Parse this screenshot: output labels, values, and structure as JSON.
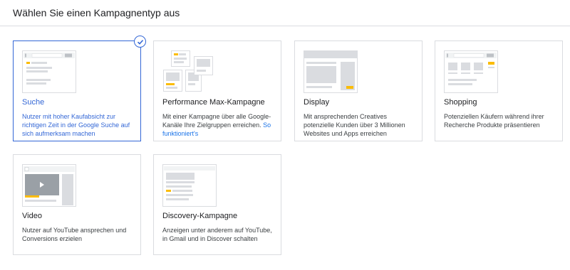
{
  "header": {
    "title": "Wählen Sie einen Kampagnentyp aus"
  },
  "cards": [
    {
      "key": "search",
      "title": "Suche",
      "desc": "Nutzer mit hoher Kaufabsicht zur richtigen Zeit in der Google Suche auf sich aufmerksam machen",
      "selected": true,
      "icon": "search-thumbnail"
    },
    {
      "key": "pmax",
      "title": "Performance Max-Kampagne",
      "desc": "Mit einer Kampagne über alle Google-Kanäle Ihre Zielgruppen erreichen.",
      "link": "So funktioniert's",
      "icon": "pmax-thumbnail"
    },
    {
      "key": "display",
      "title": "Display",
      "desc": "Mit ansprechenden Creatives potenzielle Kunden über 3 Millionen Websites und Apps erreichen",
      "icon": "display-thumbnail"
    },
    {
      "key": "shopping",
      "title": "Shopping",
      "desc": "Potenziellen Käufern während ihrer Recherche Produkte präsentieren",
      "icon": "shopping-thumbnail"
    },
    {
      "key": "video",
      "title": "Video",
      "desc": "Nutzer auf YouTube ansprechen und Conversions erzielen",
      "icon": "video-thumbnail"
    },
    {
      "key": "discovery",
      "title": "Discovery-Kampagne",
      "desc": "Anzeigen unter anderem auf YouTube, in Gmail und in Discover schalten",
      "icon": "discovery-thumbnail"
    }
  ],
  "colors": {
    "selected": "#3367d6",
    "accent": "#fbbc04",
    "border": "#dadce0",
    "placeholder": "#dadce0"
  }
}
